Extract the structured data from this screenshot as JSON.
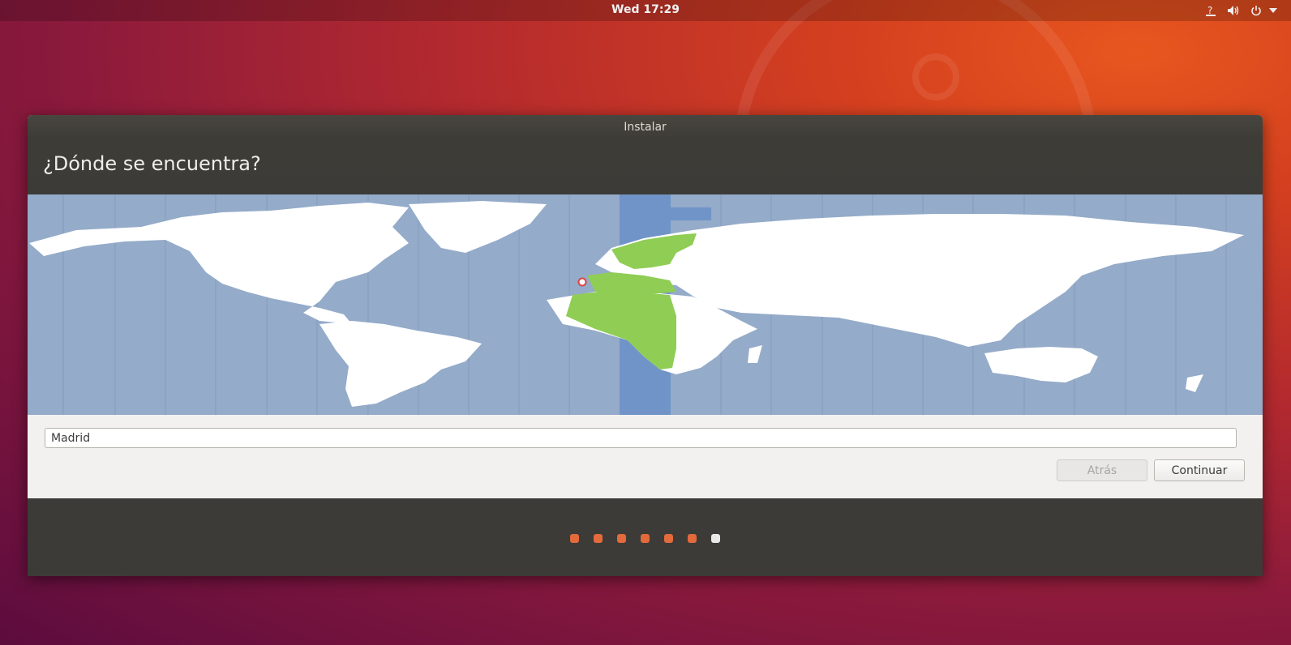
{
  "topbar": {
    "clock": "Wed 17:29",
    "icons": [
      "accessibility-question-icon",
      "volume-icon",
      "power-icon",
      "chevron-down-icon"
    ]
  },
  "window": {
    "title": "Instalar",
    "heading": "¿Dónde se encuentra?"
  },
  "map": {
    "selected_city": "Madrid",
    "highlight_color": "#8fcd55",
    "timezone_band_color": "#7094c7",
    "ocean_color": "#94abc9",
    "land_color": "#ffffff"
  },
  "location": {
    "value": "Madrid"
  },
  "buttons": {
    "back_label": "Atrás",
    "continue_label": "Continuar"
  },
  "progress": {
    "total_steps": 7,
    "current_step": 7,
    "accent": "#e26a3b"
  }
}
